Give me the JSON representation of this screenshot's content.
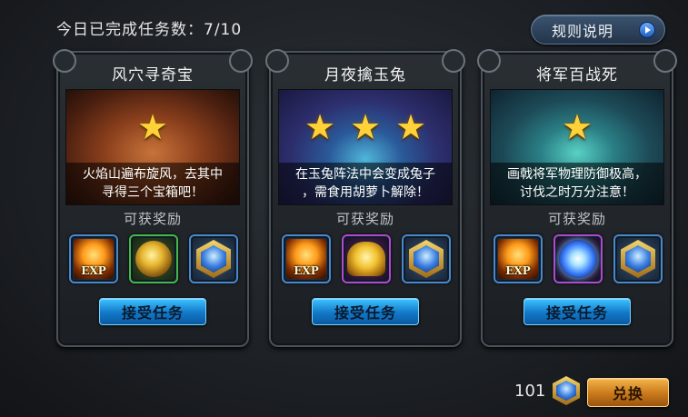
{
  "header": {
    "tasks_completed_label": "今日已完成任务数：7/10",
    "rules_button_label": "规则说明"
  },
  "reward_section_label": "可获奖励",
  "cards": [
    {
      "title": "风穴寻奇宝",
      "stars": 1,
      "description_line1": "火焰山遍布旋风，去其中",
      "description_line2": "寻得三个宝箱吧！",
      "rewards": [
        "exp-icon",
        "coins-icon",
        "gem-icon"
      ],
      "exp_text": "EXP",
      "accept_label": "接受任务"
    },
    {
      "title": "月夜擒玉兔",
      "stars": 3,
      "description_line1": "在玉兔阵法中会变成兔子",
      "description_line2": "，需食用胡萝卜解除！",
      "rewards": [
        "exp-icon",
        "gold-icon",
        "gem-icon"
      ],
      "exp_text": "EXP",
      "accept_label": "接受任务"
    },
    {
      "title": "将军百战死",
      "stars": 1,
      "description_line1": "画戟将军物理防御极高，",
      "description_line2": "讨伐之时万分注意！",
      "rewards": [
        "exp-icon",
        "orb-icon",
        "gem-icon"
      ],
      "exp_text": "EXP",
      "accept_label": "接受任务"
    }
  ],
  "footer": {
    "currency_count": "101",
    "currency_icon": "gem-icon",
    "exchange_button_label": "兑换"
  },
  "colors": {
    "accept_button": "#1278c8",
    "exchange_button": "#c9791a",
    "star": "#ffd23a"
  }
}
